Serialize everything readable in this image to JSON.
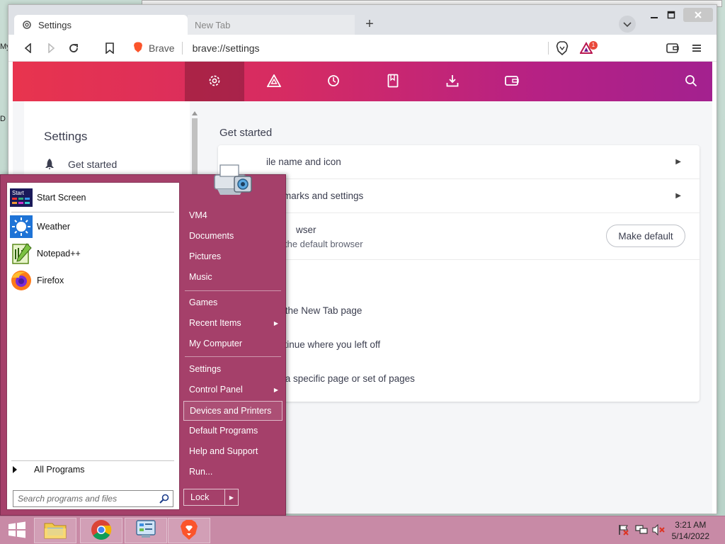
{
  "browser": {
    "tabs": [
      {
        "label": "Settings",
        "active": true
      },
      {
        "label": "New Tab",
        "active": false
      }
    ],
    "new_tab_symbol": "+",
    "omnibox": {
      "site_label": "Brave",
      "url": "brave://settings"
    },
    "rewards_badge_count": "1"
  },
  "settings": {
    "sidebar_title": "Settings",
    "sidebar_items": [
      {
        "label": "Get started",
        "icon": "rocket-icon"
      }
    ],
    "section_title": "Get started",
    "rows": [
      {
        "text": "Profile name and icon",
        "visible_text": "ile name and icon"
      },
      {
        "text": "Import bookmarks and settings",
        "visible_text": "marks and settings"
      },
      {
        "text": "Default browser",
        "visible_text": "wser",
        "sub": "the default browser",
        "button": "Make default"
      }
    ],
    "startup_options": [
      {
        "visible_text": "en the New Tab page"
      },
      {
        "visible_text": "ntinue where you left off"
      },
      {
        "visible_text": "en a specific page or set of pages"
      }
    ]
  },
  "start_menu": {
    "pinned": [
      {
        "label": "Start Screen",
        "icon": "start-screen-icon"
      },
      {
        "label": "Weather",
        "icon": "weather-icon"
      },
      {
        "label": "Notepad++",
        "icon": "notepadpp-icon"
      },
      {
        "label": "Firefox",
        "icon": "firefox-icon"
      }
    ],
    "start_icon_text": "Start",
    "all_programs": "All Programs",
    "search_placeholder": "Search programs and files",
    "right_links": [
      {
        "label": "VM4"
      },
      {
        "label": "Documents"
      },
      {
        "label": "Pictures"
      },
      {
        "label": "Music"
      },
      {
        "label": "Games"
      },
      {
        "label": "Recent Items",
        "submenu": true
      },
      {
        "label": "My Computer"
      },
      {
        "label": "Settings"
      },
      {
        "label": "Control Panel",
        "submenu": true
      },
      {
        "label": "Devices and Printers",
        "highlighted": true
      },
      {
        "label": "Default Programs"
      },
      {
        "label": "Help and Support"
      },
      {
        "label": "Run..."
      }
    ],
    "lock_label": "Lock"
  },
  "taskbar": {
    "items": [
      "start-button",
      "file-explorer-icon",
      "chrome-icon",
      "control-panel-icon",
      "brave-icon"
    ],
    "clock_time": "3:21 AM",
    "clock_date": "5/14/2022"
  },
  "colors": {
    "header_gradient_start": "#e8344e",
    "header_gradient_end": "#a3218f",
    "start_menu_bg": "#a5406a",
    "taskbar_bg": "#c88aa6"
  }
}
